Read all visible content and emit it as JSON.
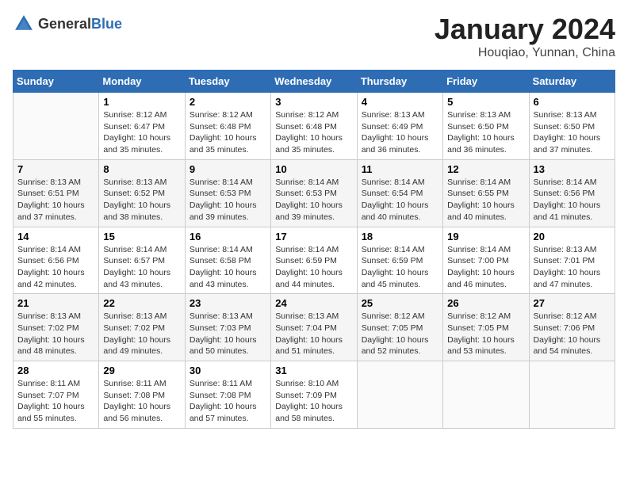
{
  "header": {
    "logo_general": "General",
    "logo_blue": "Blue",
    "title": "January 2024",
    "subtitle": "Houqiao, Yunnan, China"
  },
  "weekdays": [
    "Sunday",
    "Monday",
    "Tuesday",
    "Wednesday",
    "Thursday",
    "Friday",
    "Saturday"
  ],
  "weeks": [
    [
      {
        "day": "",
        "info": ""
      },
      {
        "day": "1",
        "info": "Sunrise: 8:12 AM\nSunset: 6:47 PM\nDaylight: 10 hours\nand 35 minutes."
      },
      {
        "day": "2",
        "info": "Sunrise: 8:12 AM\nSunset: 6:48 PM\nDaylight: 10 hours\nand 35 minutes."
      },
      {
        "day": "3",
        "info": "Sunrise: 8:12 AM\nSunset: 6:48 PM\nDaylight: 10 hours\nand 35 minutes."
      },
      {
        "day": "4",
        "info": "Sunrise: 8:13 AM\nSunset: 6:49 PM\nDaylight: 10 hours\nand 36 minutes."
      },
      {
        "day": "5",
        "info": "Sunrise: 8:13 AM\nSunset: 6:50 PM\nDaylight: 10 hours\nand 36 minutes."
      },
      {
        "day": "6",
        "info": "Sunrise: 8:13 AM\nSunset: 6:50 PM\nDaylight: 10 hours\nand 37 minutes."
      }
    ],
    [
      {
        "day": "7",
        "info": "Sunrise: 8:13 AM\nSunset: 6:51 PM\nDaylight: 10 hours\nand 37 minutes."
      },
      {
        "day": "8",
        "info": "Sunrise: 8:13 AM\nSunset: 6:52 PM\nDaylight: 10 hours\nand 38 minutes."
      },
      {
        "day": "9",
        "info": "Sunrise: 8:14 AM\nSunset: 6:53 PM\nDaylight: 10 hours\nand 39 minutes."
      },
      {
        "day": "10",
        "info": "Sunrise: 8:14 AM\nSunset: 6:53 PM\nDaylight: 10 hours\nand 39 minutes."
      },
      {
        "day": "11",
        "info": "Sunrise: 8:14 AM\nSunset: 6:54 PM\nDaylight: 10 hours\nand 40 minutes."
      },
      {
        "day": "12",
        "info": "Sunrise: 8:14 AM\nSunset: 6:55 PM\nDaylight: 10 hours\nand 40 minutes."
      },
      {
        "day": "13",
        "info": "Sunrise: 8:14 AM\nSunset: 6:56 PM\nDaylight: 10 hours\nand 41 minutes."
      }
    ],
    [
      {
        "day": "14",
        "info": "Sunrise: 8:14 AM\nSunset: 6:56 PM\nDaylight: 10 hours\nand 42 minutes."
      },
      {
        "day": "15",
        "info": "Sunrise: 8:14 AM\nSunset: 6:57 PM\nDaylight: 10 hours\nand 43 minutes."
      },
      {
        "day": "16",
        "info": "Sunrise: 8:14 AM\nSunset: 6:58 PM\nDaylight: 10 hours\nand 43 minutes."
      },
      {
        "day": "17",
        "info": "Sunrise: 8:14 AM\nSunset: 6:59 PM\nDaylight: 10 hours\nand 44 minutes."
      },
      {
        "day": "18",
        "info": "Sunrise: 8:14 AM\nSunset: 6:59 PM\nDaylight: 10 hours\nand 45 minutes."
      },
      {
        "day": "19",
        "info": "Sunrise: 8:14 AM\nSunset: 7:00 PM\nDaylight: 10 hours\nand 46 minutes."
      },
      {
        "day": "20",
        "info": "Sunrise: 8:13 AM\nSunset: 7:01 PM\nDaylight: 10 hours\nand 47 minutes."
      }
    ],
    [
      {
        "day": "21",
        "info": "Sunrise: 8:13 AM\nSunset: 7:02 PM\nDaylight: 10 hours\nand 48 minutes."
      },
      {
        "day": "22",
        "info": "Sunrise: 8:13 AM\nSunset: 7:02 PM\nDaylight: 10 hours\nand 49 minutes."
      },
      {
        "day": "23",
        "info": "Sunrise: 8:13 AM\nSunset: 7:03 PM\nDaylight: 10 hours\nand 50 minutes."
      },
      {
        "day": "24",
        "info": "Sunrise: 8:13 AM\nSunset: 7:04 PM\nDaylight: 10 hours\nand 51 minutes."
      },
      {
        "day": "25",
        "info": "Sunrise: 8:12 AM\nSunset: 7:05 PM\nDaylight: 10 hours\nand 52 minutes."
      },
      {
        "day": "26",
        "info": "Sunrise: 8:12 AM\nSunset: 7:05 PM\nDaylight: 10 hours\nand 53 minutes."
      },
      {
        "day": "27",
        "info": "Sunrise: 8:12 AM\nSunset: 7:06 PM\nDaylight: 10 hours\nand 54 minutes."
      }
    ],
    [
      {
        "day": "28",
        "info": "Sunrise: 8:11 AM\nSunset: 7:07 PM\nDaylight: 10 hours\nand 55 minutes."
      },
      {
        "day": "29",
        "info": "Sunrise: 8:11 AM\nSunset: 7:08 PM\nDaylight: 10 hours\nand 56 minutes."
      },
      {
        "day": "30",
        "info": "Sunrise: 8:11 AM\nSunset: 7:08 PM\nDaylight: 10 hours\nand 57 minutes."
      },
      {
        "day": "31",
        "info": "Sunrise: 8:10 AM\nSunset: 7:09 PM\nDaylight: 10 hours\nand 58 minutes."
      },
      {
        "day": "",
        "info": ""
      },
      {
        "day": "",
        "info": ""
      },
      {
        "day": "",
        "info": ""
      }
    ]
  ]
}
